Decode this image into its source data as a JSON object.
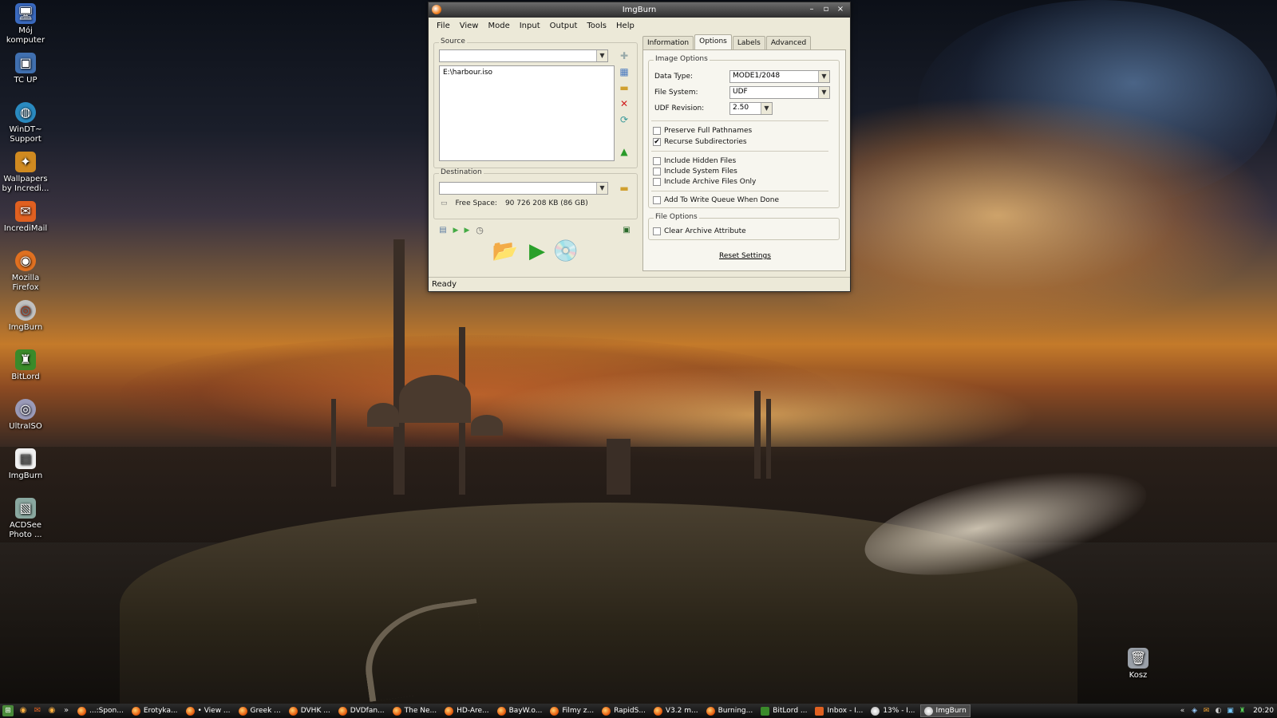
{
  "desktop": {
    "icons": [
      {
        "label": "Mój komputer",
        "icon": "computer-icon"
      },
      {
        "label": "TC UP",
        "icon": "floppy-icon"
      },
      {
        "label": "WinDT~ Support",
        "icon": "globe-icon"
      },
      {
        "label": "Wallpapers by Incredi...",
        "icon": "wallpaper-icon"
      },
      {
        "label": "IncrediMail",
        "icon": "envelope-icon"
      },
      {
        "label": "Mozilla Firefox",
        "icon": "firefox-icon"
      },
      {
        "label": "ImgBurn",
        "icon": "imgburn-icon"
      },
      {
        "label": "BitLord",
        "icon": "bitlord-icon"
      },
      {
        "label": "UltraISO",
        "icon": "disc-icon"
      },
      {
        "label": "ImgBurn",
        "icon": "document-icon"
      },
      {
        "label": "ACDSee Photo ...",
        "icon": "photo-icon"
      }
    ],
    "recycle_bin": {
      "label": "Kosz",
      "icon": "trash-icon"
    }
  },
  "window": {
    "title": "ImgBurn",
    "controls": {
      "minimize": "–",
      "maximize": "▫",
      "close": "×"
    },
    "menu": [
      "File",
      "View",
      "Mode",
      "Input",
      "Output",
      "Tools",
      "Help"
    ],
    "source": {
      "group_label": "Source",
      "combo_value": "",
      "items": [
        "E:\\harbour.iso"
      ]
    },
    "destination": {
      "group_label": "Destination",
      "combo_value": "",
      "free_space_label": "Free Space:",
      "free_space_value": "90 726 208 KB (86 GB)"
    },
    "tabs": [
      "Information",
      "Options",
      "Labels",
      "Advanced"
    ],
    "active_tab": "Options",
    "image_options": {
      "group_label": "Image Options",
      "data_type_label": "Data Type:",
      "data_type_value": "MODE1/2048",
      "file_system_label": "File System:",
      "file_system_value": "UDF",
      "udf_revision_label": "UDF Revision:",
      "udf_revision_value": "2.50",
      "checkboxes": [
        {
          "label": "Preserve Full Pathnames",
          "checked": false
        },
        {
          "label": "Recurse Subdirectories",
          "checked": true
        },
        {
          "label": "Include Hidden Files",
          "checked": false
        },
        {
          "label": "Include System Files",
          "checked": false
        },
        {
          "label": "Include Archive Files Only",
          "checked": false
        },
        {
          "label": "Add To Write Queue When Done",
          "checked": false
        }
      ]
    },
    "file_options": {
      "group_label": "File Options",
      "checkboxes": [
        {
          "label": "Clear Archive Attribute",
          "checked": false
        }
      ]
    },
    "reset_label": "Reset Settings",
    "status": "Ready"
  },
  "taskbar": {
    "buttons": [
      "...:Spon...",
      "Erotyka...",
      "• View ...",
      "Greek ...",
      "DVHK ...",
      "DVDfan...",
      "The Ne...",
      "HD-Are...",
      "BayW.o...",
      "Filmy z...",
      "RapidS...",
      "V3.2 m...",
      "Burning...",
      "BitLord ...",
      "Inbox - I...",
      "13% - I...",
      "ImgBurn"
    ],
    "active_button": "ImgBurn",
    "clock": "20:20"
  }
}
